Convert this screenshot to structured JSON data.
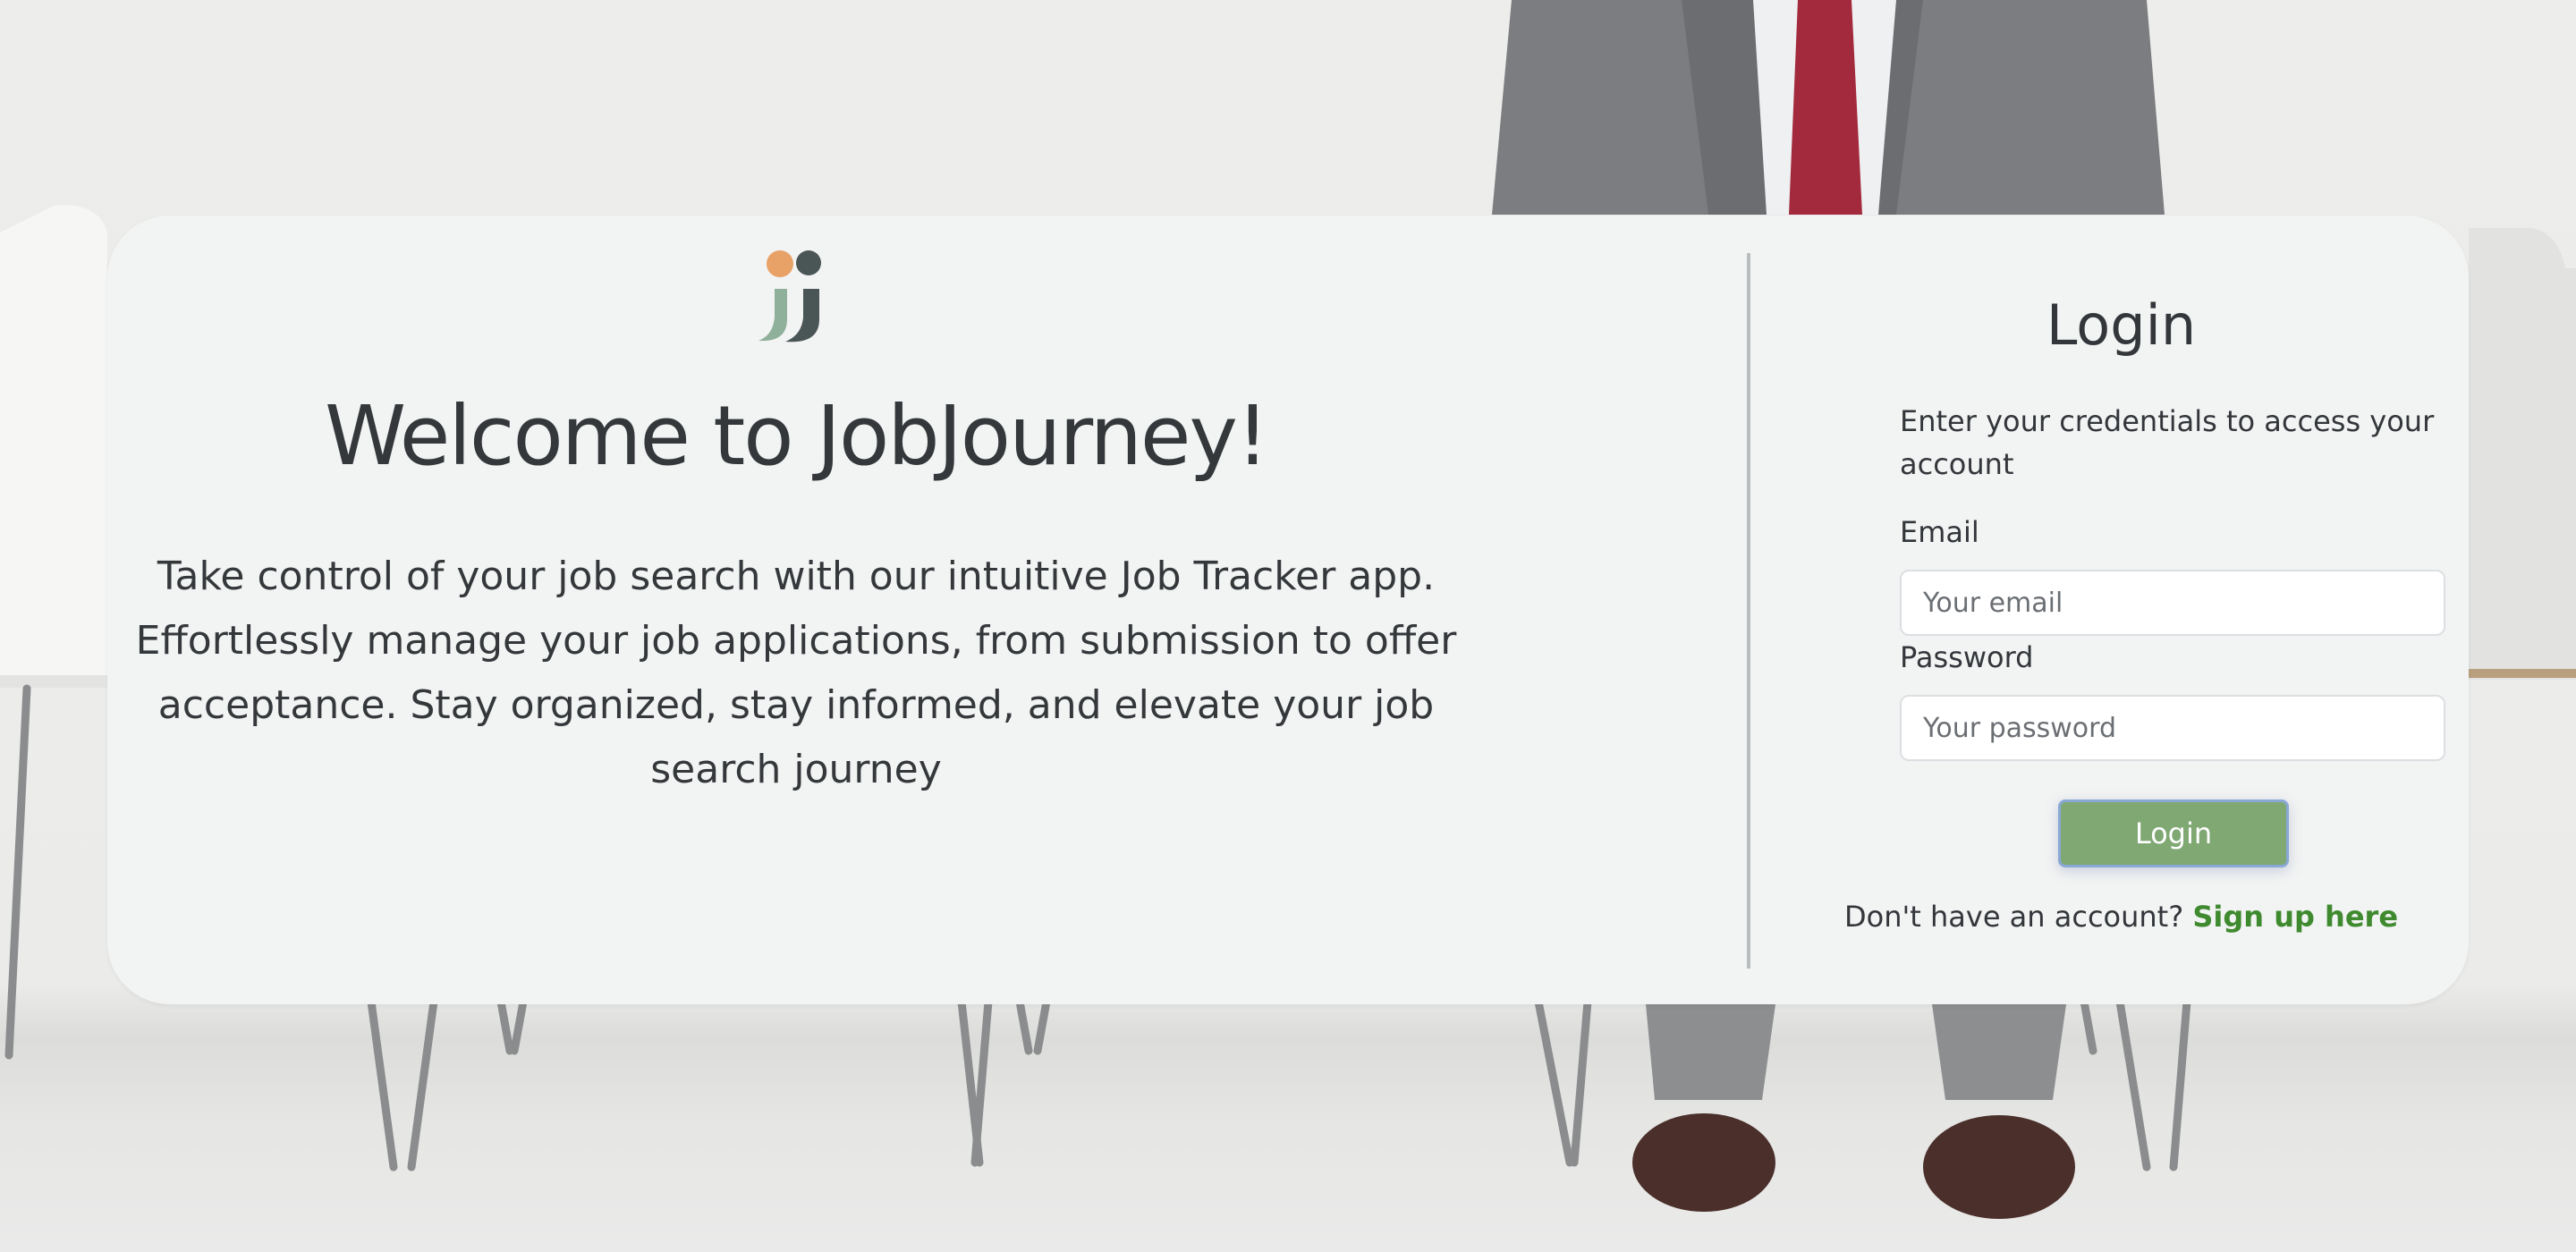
{
  "welcome": {
    "heading": "Welcome to JobJourney!",
    "description": "Take control of your job search with our intuitive Job Tracker app. Effortlessly manage your job applications, from submission to offer acceptance. Stay organized, stay informed, and elevate your job search journey"
  },
  "logo": {
    "icon": "jj-logo-icon",
    "colors": {
      "dot_left": "#e8a166",
      "dot_right": "#4a5556",
      "j_left": "#8fb09a",
      "j_right": "#4a5556"
    }
  },
  "login": {
    "title": "Login",
    "subtitle": "Enter your credentials to access your account",
    "email_label": "Email",
    "email_placeholder": "Your email",
    "password_label": "Password",
    "password_placeholder": "Your password",
    "button_label": "Login",
    "signup_prompt": "Don't have an account?",
    "signup_link": "Sign up here"
  },
  "colors": {
    "accent_button": "#7fa873",
    "link": "#3f8a2f",
    "card_background": "#f2f3f3"
  }
}
